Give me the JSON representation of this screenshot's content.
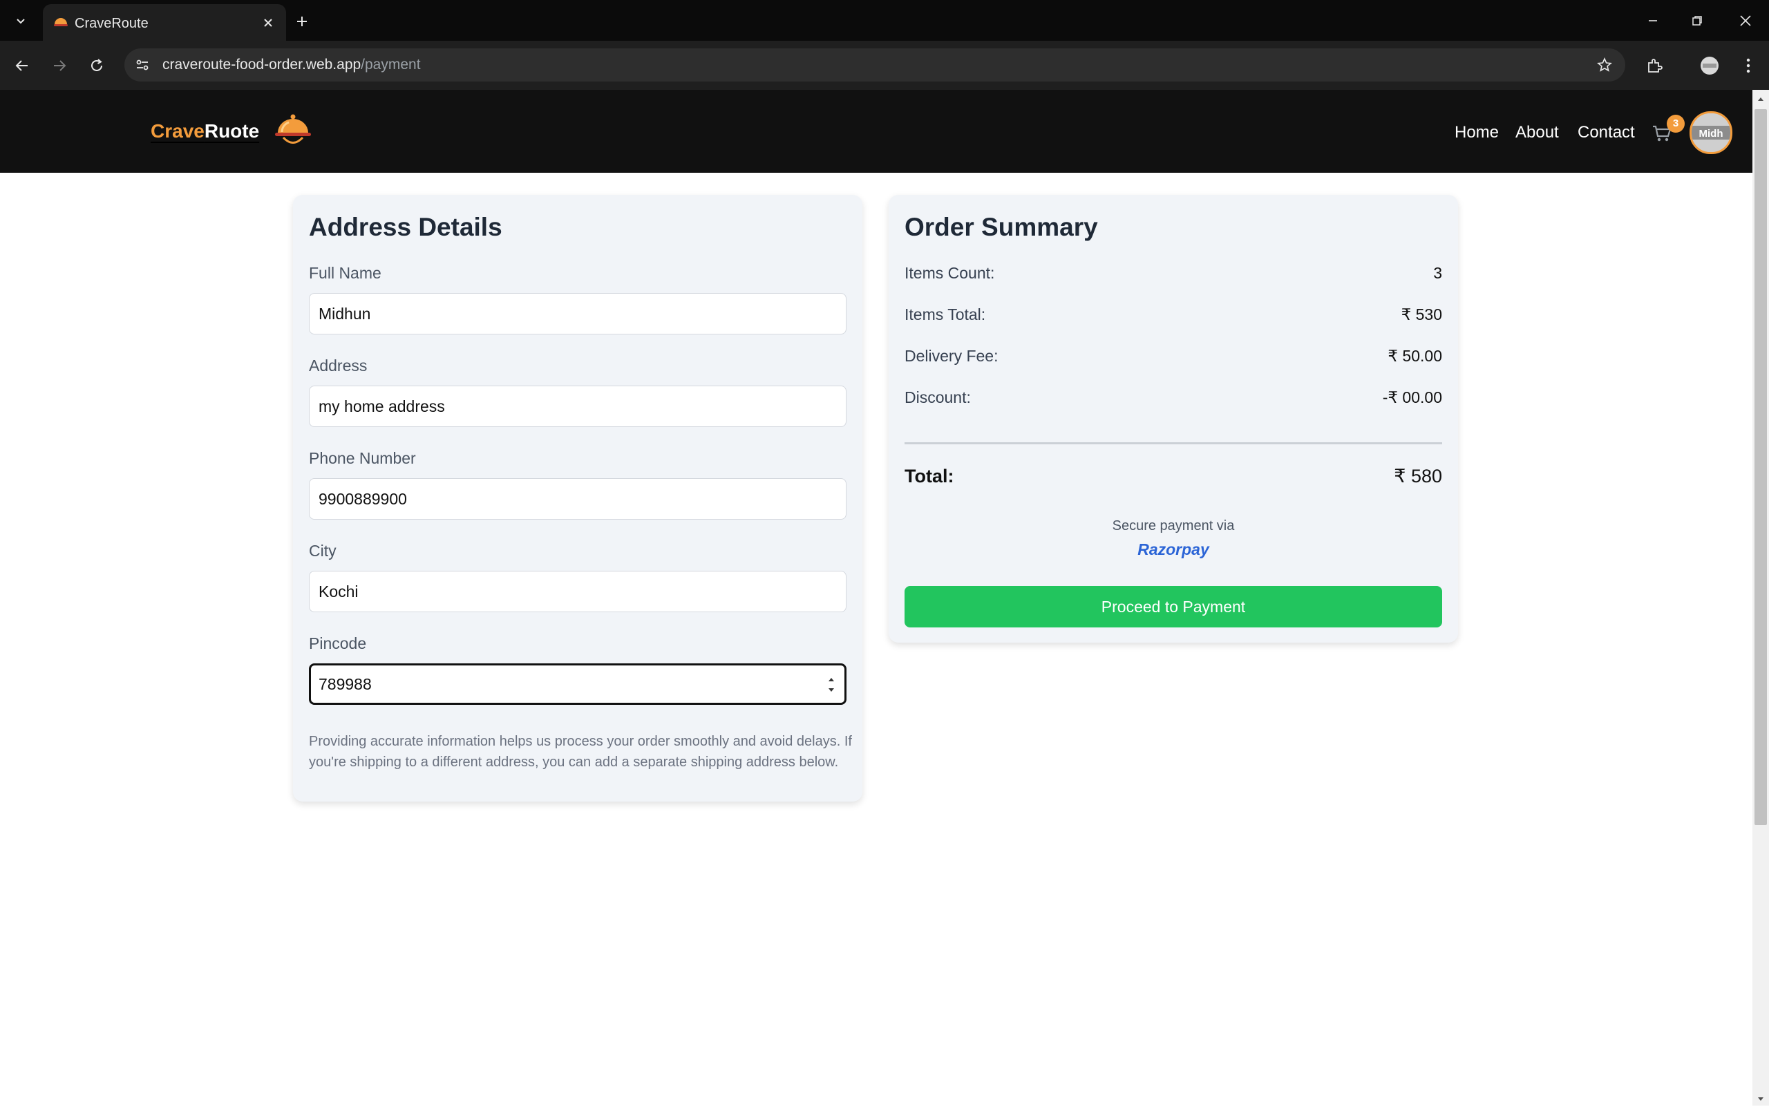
{
  "browser": {
    "tab_title": "CraveRoute",
    "url_host": "craveroute-food-order.web.app",
    "url_path": "/payment"
  },
  "header": {
    "brand_part1": "Crave",
    "brand_part2": "Ruote",
    "nav": [
      "Home",
      "About",
      "Contact"
    ],
    "cart_count": "3",
    "avatar_text": "Midh"
  },
  "address": {
    "title": "Address Details",
    "fields": [
      {
        "label": "Full Name",
        "value": "Midhun"
      },
      {
        "label": "Address",
        "value": "my home address"
      },
      {
        "label": "Phone Number",
        "value": "9900889900"
      },
      {
        "label": "City",
        "value": "Kochi"
      },
      {
        "label": "Pincode",
        "value": "789988"
      }
    ],
    "hint": "Providing accurate information helps us process your order smoothly and avoid delays. If you're shipping to a different address, you can add a separate shipping address below."
  },
  "summary": {
    "title": "Order Summary",
    "rows": [
      {
        "label": "Items Count:",
        "value": "3"
      },
      {
        "label": "Items Total:",
        "value": "₹ 530"
      },
      {
        "label": "Delivery Fee:",
        "value": "₹ 50.00"
      },
      {
        "label": "Discount:",
        "value": "-₹ 00.00"
      }
    ],
    "total_label": "Total:",
    "total_value": "₹ 580",
    "secure_text": "Secure payment via",
    "provider": "Razorpay",
    "button_label": "Proceed to Payment"
  },
  "colors": {
    "accent": "#f39c3c",
    "pay_button": "#22c55e",
    "razorpay_blue": "#2b64d6",
    "header_bg": "#111111"
  }
}
